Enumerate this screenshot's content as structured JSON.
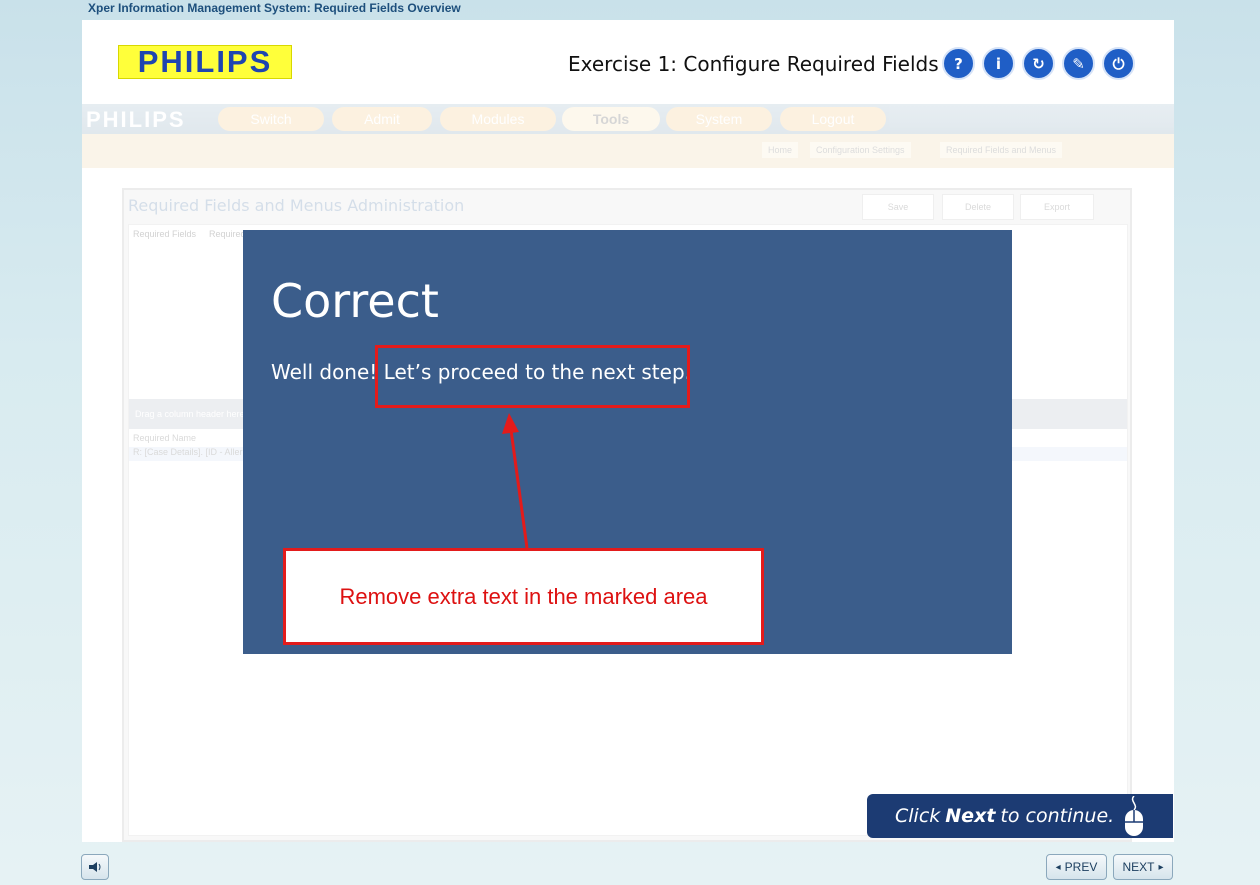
{
  "window": {
    "title": "Xper Information Management System: Required Fields Overview"
  },
  "header": {
    "logo_text": "PHILIPS",
    "exercise_title": "Exercise 1: Configure Required Fields",
    "buttons": [
      {
        "icon": "help-icon",
        "glyph": "?"
      },
      {
        "icon": "info-icon",
        "glyph": "i"
      },
      {
        "icon": "restart-icon",
        "glyph": "↻"
      },
      {
        "icon": "pen-icon",
        "glyph": "✎"
      },
      {
        "icon": "power-icon",
        "glyph": "⏻"
      }
    ]
  },
  "app": {
    "logo": "PHILIPS",
    "nav": [
      "Switch",
      "Admit",
      "Modules",
      "Tools",
      "System",
      "Logout"
    ],
    "breadcrumbs": [
      "Home",
      "Configuration Settings",
      "Required Fields and Menus"
    ],
    "panel_title": "Required Fields and Menus Administration",
    "panel_buttons": [
      "Save",
      "Delete",
      "Export"
    ],
    "tabs": [
      "Required Fields",
      "Required"
    ],
    "grid_hint": "Drag a column header here",
    "grid_header": "Required Name",
    "grid_row": "R: [Case Details]. [ID - Aller"
  },
  "modal": {
    "title": "Correct",
    "message": "Well done! Let’s proceed to the next step.",
    "callout": "Remove extra text in the marked area"
  },
  "hint": {
    "prefix": "Click",
    "bold": "Next",
    "suffix": "to continue."
  },
  "footer": {
    "audio_icon": "speaker-icon",
    "prev": "PREV",
    "next": "NEXT"
  },
  "colors": {
    "modal_bg": "#3b5d8b",
    "annotation_red": "#e31b1b",
    "brand_blue": "#1f5ec6"
  }
}
